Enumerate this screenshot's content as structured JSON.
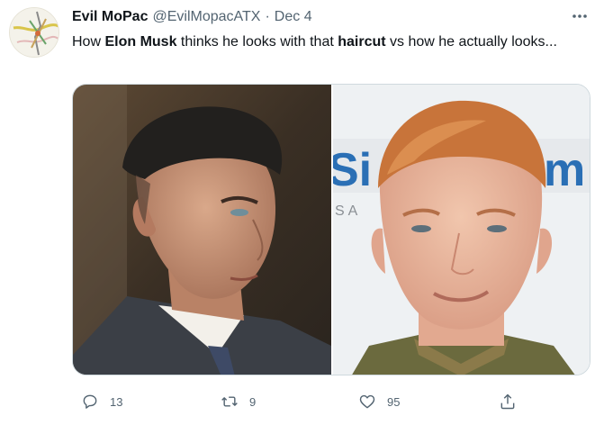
{
  "tweet": {
    "author_name": "Evil MoPac",
    "author_handle": "@EvilMopacATX",
    "separator": "·",
    "date": "Dec 4",
    "text_parts": {
      "p1": "How ",
      "b1": "Elon Musk",
      "p2": " thinks he looks with that ",
      "b2": "haircut",
      "p3": " vs how he actually looks..."
    },
    "media": {
      "left_image": "man with short slicked-back dark undercut hair in a suit",
      "right_image": "man with short ginger undercut hair in front of a radio banner",
      "right_banner_text_1": "Si",
      "right_banner_text_2": "m",
      "right_banner_sub": "SA"
    }
  },
  "actions": {
    "reply_count": "13",
    "retweet_count": "9",
    "like_count": "95"
  },
  "icons": {
    "more": "more-icon",
    "reply": "reply-icon",
    "retweet": "retweet-icon",
    "like": "heart-icon",
    "share": "share-icon"
  },
  "colors": {
    "text": "#0f1419",
    "secondary": "#536471",
    "border": "#cfd9de"
  }
}
